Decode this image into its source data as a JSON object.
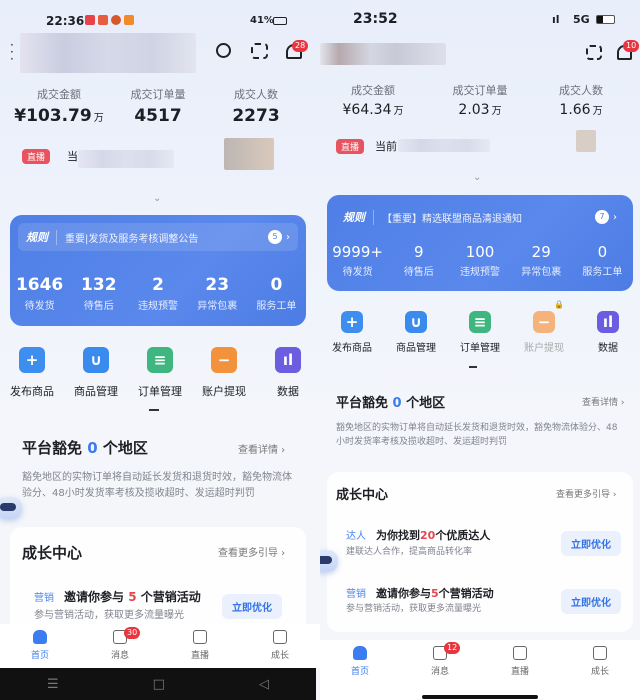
{
  "left": {
    "status": {
      "time": "22:36",
      "battery": "41%"
    },
    "header": {
      "notif_badge": "28"
    },
    "metrics": [
      {
        "label": "成交金额",
        "value": "¥103.79",
        "unit": "万"
      },
      {
        "label": "成交订单量",
        "value": "4517",
        "unit": ""
      },
      {
        "label": "成交人数",
        "value": "2273",
        "unit": ""
      }
    ],
    "live": {
      "badge": "直播",
      "text": "当"
    },
    "notice": {
      "tag": "规则",
      "text": "重要|发货及服务考核调整公告",
      "count": "5"
    },
    "stats": [
      {
        "n": "1646",
        "l": "待发货"
      },
      {
        "n": "132",
        "l": "待售后"
      },
      {
        "n": "2",
        "l": "违规预警"
      },
      {
        "n": "23",
        "l": "异常包裹"
      },
      {
        "n": "0",
        "l": "服务工单"
      }
    ],
    "tools": [
      "发布商品",
      "商品管理",
      "订单管理",
      "账户提现",
      "数据"
    ],
    "exempt": {
      "pre": "平台豁免 ",
      "num": "0",
      "post": " 个地区",
      "more": "查看详情 ›",
      "desc": "豁免地区的实物订单将自动延长发货和退货时效，豁免物流体验分、48小时发货率考核及揽收超时、发运超时判罚"
    },
    "growth": {
      "title": "成长中心",
      "more": "查看更多引导 ›",
      "items": [
        {
          "tag": "营销",
          "pre": "邀请你参与 ",
          "num": "5",
          "post": " 个营销活动",
          "sub": "参与营销活动，获取更多流量曝光",
          "btn": "立即优化"
        }
      ]
    },
    "nav": [
      {
        "label": "首页"
      },
      {
        "label": "消息",
        "badge": "30"
      },
      {
        "label": "直播"
      },
      {
        "label": "成长"
      }
    ]
  },
  "right": {
    "status": {
      "time": "23:52",
      "network": "5G"
    },
    "header": {
      "notif_badge": "10"
    },
    "metrics": [
      {
        "label": "成交金额",
        "value": "¥64.34",
        "unit": "万"
      },
      {
        "label": "成交订单量",
        "value": "2.03",
        "unit": "万"
      },
      {
        "label": "成交人数",
        "value": "1.66",
        "unit": "万"
      }
    ],
    "live": {
      "badge": "直播",
      "text": "当前"
    },
    "notice": {
      "tag": "规则",
      "text": "【重要】精选联盟商品清退通知",
      "count": "7"
    },
    "stats": [
      {
        "n": "9999+",
        "l": "待发货"
      },
      {
        "n": "9",
        "l": "待售后"
      },
      {
        "n": "100",
        "l": "违规预警"
      },
      {
        "n": "29",
        "l": "异常包裹"
      },
      {
        "n": "0",
        "l": "服务工单"
      }
    ],
    "tools": [
      "发布商品",
      "商品管理",
      "订单管理",
      "账户提现",
      "数据"
    ],
    "exempt": {
      "pre": "平台豁免 ",
      "num": "0",
      "post": " 个地区",
      "more": "查看详情 ›",
      "desc": "豁免地区的实物订单将自动延长发货和退货时效，豁免物流体验分、48小时发货率考核及揽收超时、发运超时判罚"
    },
    "growth": {
      "title": "成长中心",
      "more": "查看更多引导 ›",
      "items": [
        {
          "tag": "达人",
          "pre": "为你找到",
          "num": "20",
          "post": "个优质达人",
          "sub": "建联达人合作，提高商品转化率",
          "btn": "立即优化"
        },
        {
          "tag": "营销",
          "pre": "邀请你参与",
          "num": "5",
          "post": "个营销活动",
          "sub": "参与营销活动，获取更多流量曝光",
          "btn": "立即优化"
        }
      ]
    },
    "nav": [
      {
        "label": "首页"
      },
      {
        "label": "消息",
        "badge": "12"
      },
      {
        "label": "直播"
      },
      {
        "label": "成长"
      }
    ]
  },
  "colors": {
    "accent": "#3b7cf0",
    "card": "#5a88ec",
    "live": "#e8535f",
    "badge": "#e8353f"
  }
}
